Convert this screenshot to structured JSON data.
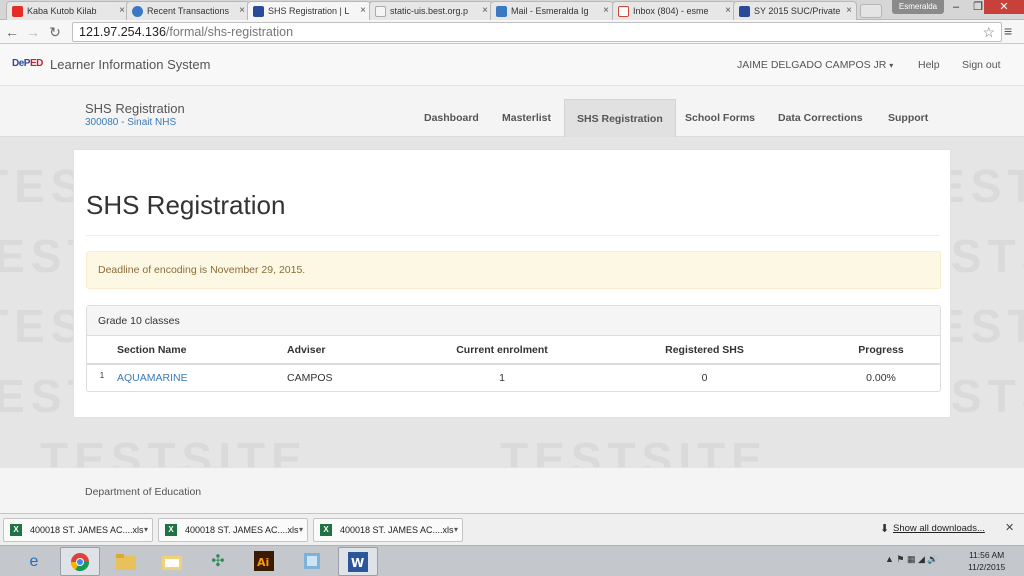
{
  "browser": {
    "tabs": [
      {
        "title": "Kaba Kutob Kilab",
        "favicon_color": "#e52d27",
        "active": false
      },
      {
        "title": "Recent Transactions",
        "favicon_color": "#3b78c4",
        "active": false
      },
      {
        "title": "SHS Registration | L",
        "favicon_color": "#2a4a9a",
        "active": true
      },
      {
        "title": "static-uis.best.org.p",
        "favicon_color": "#cfcfcf",
        "active": false
      },
      {
        "title": "Mail - Esmeralda Ig",
        "favicon_color": "#3b78c4",
        "active": false
      },
      {
        "title": "Inbox (804) - esme",
        "favicon_color": "#d44638",
        "active": false
      },
      {
        "title": "SY 2015 SUC/Private",
        "favicon_color": "#2a4a9a",
        "active": false
      }
    ],
    "window_user": "Esmeralda",
    "address": {
      "host": "121.97.254.136",
      "path": "/formal/shs-registration"
    }
  },
  "site": {
    "logo": {
      "part1": "DeP",
      "part2": "ED"
    },
    "app_title": "Learner Information System",
    "user": "JAIME DELGADO CAMPOS JR",
    "help": "Help",
    "signout": "Sign out",
    "school_title": "SHS Registration",
    "school_id": "300080 - Sinait NHS",
    "nav": [
      {
        "label": "Dashboard",
        "active": false
      },
      {
        "label": "Masterlist",
        "active": false
      },
      {
        "label": "SHS Registration",
        "active": true
      },
      {
        "label": "School Forms",
        "active": false
      },
      {
        "label": "Data Corrections",
        "active": false
      },
      {
        "label": "Support",
        "active": false
      }
    ],
    "watermark": "TESTSITE"
  },
  "main": {
    "page_title": "SHS Registration",
    "alert": "Deadline of encoding is November 29, 2015.",
    "classes_heading": "Grade 10 classes",
    "table": {
      "headers": [
        "Section Name",
        "Adviser",
        "Current enrolment",
        "Registered SHS",
        "Progress"
      ],
      "rows": [
        {
          "num": "1",
          "section": "AQUAMARINE",
          "adviser": "CAMPOS",
          "enrolment": "1",
          "registered": "0",
          "progress": "0.00%"
        }
      ]
    }
  },
  "footer": {
    "text": "Department of Education"
  },
  "downloads": {
    "items": [
      "400018 ST. JAMES AC....xls",
      "400018 ST. JAMES AC....xls",
      "400018 ST. JAMES AC....xls"
    ],
    "show_all": "Show all downloads...",
    "file_badge": "X"
  },
  "taskbar": {
    "clock_time": "11:56 AM",
    "clock_date": "11/2/2015"
  }
}
